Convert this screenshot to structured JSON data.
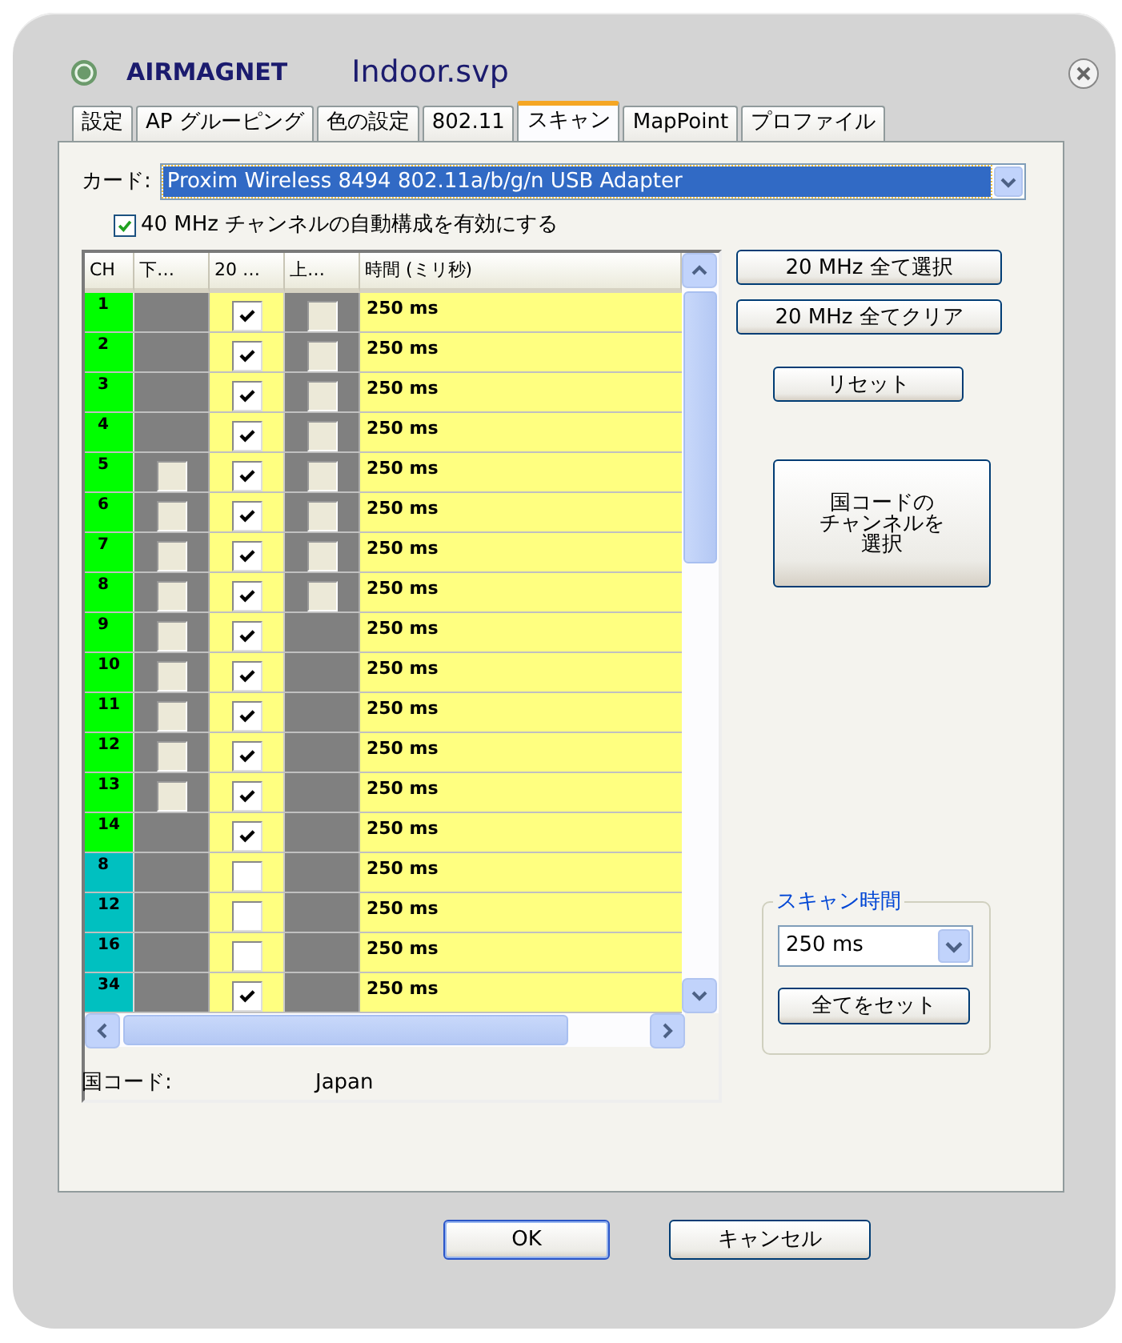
{
  "window": {
    "brand": "AIRMAGNET",
    "title": "Indoor.svp"
  },
  "tabs": [
    {
      "label": "設定",
      "selected": false
    },
    {
      "label": "AP グルーピング",
      "selected": false
    },
    {
      "label": "色の設定",
      "selected": false
    },
    {
      "label": "802.11",
      "selected": false
    },
    {
      "label": "スキャン",
      "selected": true
    },
    {
      "label": "MapPoint",
      "selected": false
    },
    {
      "label": "プロファイル",
      "selected": false
    }
  ],
  "card": {
    "label": "カード:",
    "value": "Proxim Wireless 8494 802.11a/b/g/n USB Adapter"
  },
  "auto_40mhz": {
    "label": "40 MHz チャンネルの自動構成を有効にする",
    "checked": true
  },
  "table": {
    "columns": [
      "CH",
      "下…",
      "20 …",
      "上…",
      "時間 (ミリ秒)"
    ],
    "rows": [
      {
        "ch": "1",
        "color": "#00ff00",
        "ht20": {
          "checked": true
        },
        "upper": {
          "checked": false
        },
        "time": "250 ms"
      },
      {
        "ch": "2",
        "color": "#00ff00",
        "ht20": {
          "checked": true
        },
        "upper": {
          "checked": false
        },
        "time": "250 ms"
      },
      {
        "ch": "3",
        "color": "#00ff00",
        "ht20": {
          "checked": true
        },
        "upper": {
          "checked": false
        },
        "time": "250 ms"
      },
      {
        "ch": "4",
        "color": "#00ff00",
        "ht20": {
          "checked": true
        },
        "upper": {
          "checked": false
        },
        "time": "250 ms"
      },
      {
        "ch": "5",
        "color": "#00ff00",
        "lower": {
          "checked": false
        },
        "ht20": {
          "checked": true
        },
        "upper": {
          "checked": false
        },
        "time": "250 ms"
      },
      {
        "ch": "6",
        "color": "#00ff00",
        "lower": {
          "checked": false
        },
        "ht20": {
          "checked": true
        },
        "upper": {
          "checked": false
        },
        "time": "250 ms"
      },
      {
        "ch": "7",
        "color": "#00ff00",
        "lower": {
          "checked": false
        },
        "ht20": {
          "checked": true
        },
        "upper": {
          "checked": false
        },
        "time": "250 ms"
      },
      {
        "ch": "8",
        "color": "#00ff00",
        "lower": {
          "checked": false
        },
        "ht20": {
          "checked": true
        },
        "upper": {
          "checked": false
        },
        "time": "250 ms"
      },
      {
        "ch": "9",
        "color": "#00ff00",
        "lower": {
          "checked": false
        },
        "ht20": {
          "checked": true
        },
        "time": "250 ms"
      },
      {
        "ch": "10",
        "color": "#00ff00",
        "lower": {
          "checked": false
        },
        "ht20": {
          "checked": true
        },
        "time": "250 ms"
      },
      {
        "ch": "11",
        "color": "#00ff00",
        "lower": {
          "checked": false
        },
        "ht20": {
          "checked": true
        },
        "time": "250 ms"
      },
      {
        "ch": "12",
        "color": "#00ff00",
        "lower": {
          "checked": false
        },
        "ht20": {
          "checked": true
        },
        "time": "250 ms"
      },
      {
        "ch": "13",
        "color": "#00ff00",
        "lower": {
          "checked": false
        },
        "ht20": {
          "checked": true
        },
        "time": "250 ms"
      },
      {
        "ch": "14",
        "color": "#00ff00",
        "ht20": {
          "checked": true
        },
        "time": "250 ms"
      },
      {
        "ch": "8",
        "color": "#00c0c0",
        "ht20": {
          "checked": false
        },
        "time": "250 ms"
      },
      {
        "ch": "12",
        "color": "#00c0c0",
        "ht20": {
          "checked": false
        },
        "time": "250 ms"
      },
      {
        "ch": "16",
        "color": "#00c0c0",
        "ht20": {
          "checked": false
        },
        "time": "250 ms"
      },
      {
        "ch": "34",
        "color": "#00c0c0",
        "ht20": {
          "checked": true
        },
        "time": "250 ms"
      }
    ]
  },
  "side_buttons": [
    "20 MHz 全て選択",
    "20 MHz 全てクリア",
    "リセット",
    {
      "lines": [
        "国コードの",
        "チャンネルを",
        "選択"
      ]
    }
  ],
  "scan_time": {
    "legend": "スキャン時間",
    "value": "250 ms",
    "button": "全てをセット"
  },
  "country": {
    "label": "国コード:",
    "value": "Japan"
  },
  "footer_buttons": [
    "OK",
    "キャンセル"
  ]
}
